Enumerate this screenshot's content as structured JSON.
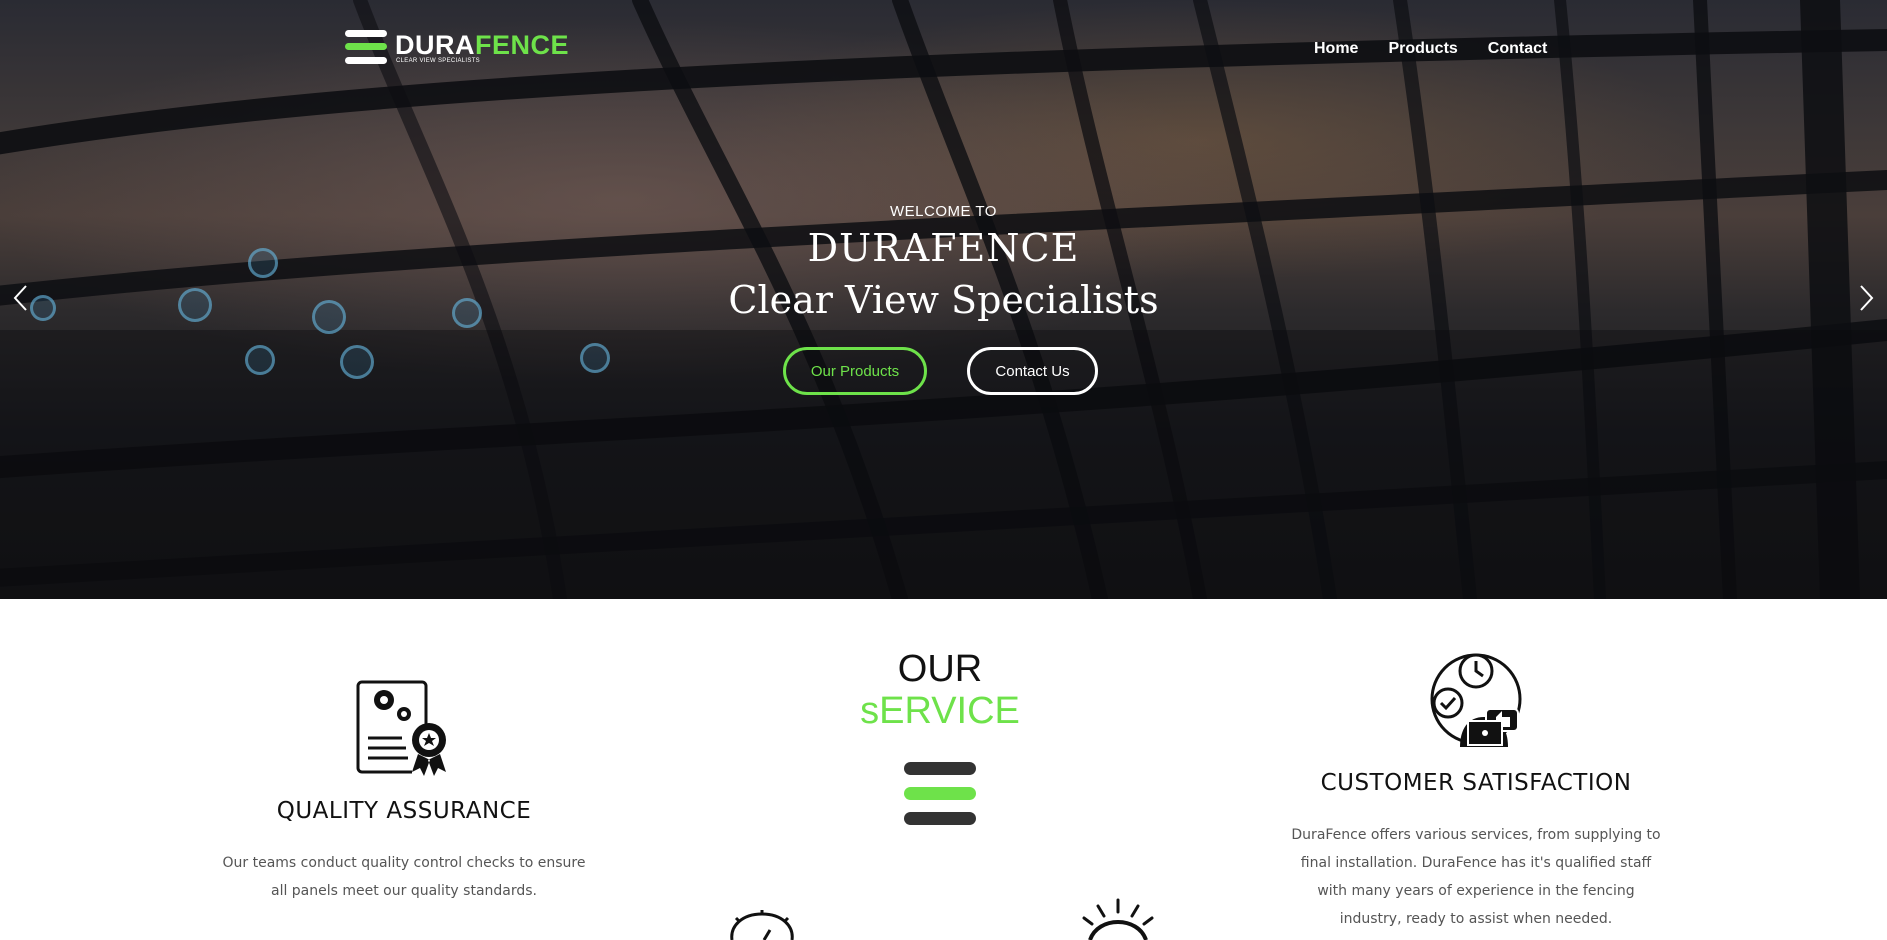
{
  "brand": {
    "logo_left": "DURA",
    "logo_right": "FENCE",
    "logo_tagline": "CLEAR VIEW SPECIALISTS"
  },
  "nav": {
    "items": [
      "Home",
      "Products",
      "Contact"
    ]
  },
  "hero": {
    "welcome": "WELCOME TO",
    "title": "DURAFENCE",
    "subtitle": "Clear View Specialists",
    "primary_button": "Our Products",
    "secondary_button": "Contact Us",
    "prev_icon": "chevron-left-icon",
    "next_icon": "chevron-right-icon"
  },
  "services": {
    "heading_top": "OUR",
    "heading_bottom": "sERVICE",
    "quality": {
      "title": "QUALITY ASSURANCE",
      "description_line1": "Our teams conduct quality control checks to ensure",
      "description_line2": "all panels meet our quality standards.",
      "icon": "certificate-gears-icon"
    },
    "customer": {
      "title": "CUSTOMER SATISFACTION",
      "description_line1": "DuraFence offers various services, from supplying to",
      "description_line2": "final installation. DuraFence has it's qualified staff",
      "description_line3": "with many years of experience in the fencing",
      "description_line4": "industry, ready to assist when needed.",
      "icon": "satisfied-customer-icon"
    },
    "partial_icons": [
      "badge-check-icon",
      "sun-rays-icon"
    ]
  },
  "colors": {
    "accent_green": "#6ee24a",
    "dark_bar": "#333333",
    "text_dark": "#111111",
    "text_muted": "#555555"
  }
}
